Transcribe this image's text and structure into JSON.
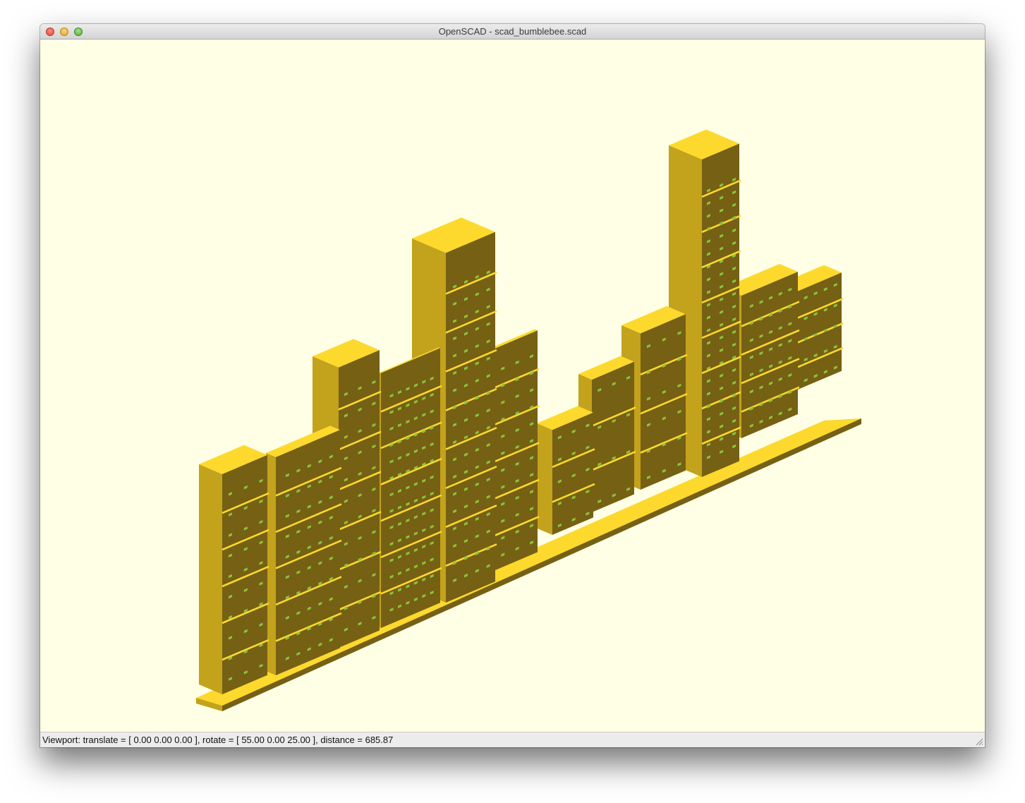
{
  "window": {
    "title": "OpenSCAD - scad_bumblebee.scad"
  },
  "statusbar": {
    "text": "Viewport: translate = [ 0.00 0.00 0.00 ], rotate = [ 55.00 0.00 25.00 ], distance = 685.87"
  },
  "colors": {
    "background": "#ffffe5",
    "face_top": "#fcd92c",
    "face_left": "#c3a21c",
    "face_front": "#756014",
    "window": "#8cc23c"
  },
  "icons": [
    "close-icon",
    "minimize-icon",
    "zoom-icon",
    "resize-grip-icon"
  ]
}
